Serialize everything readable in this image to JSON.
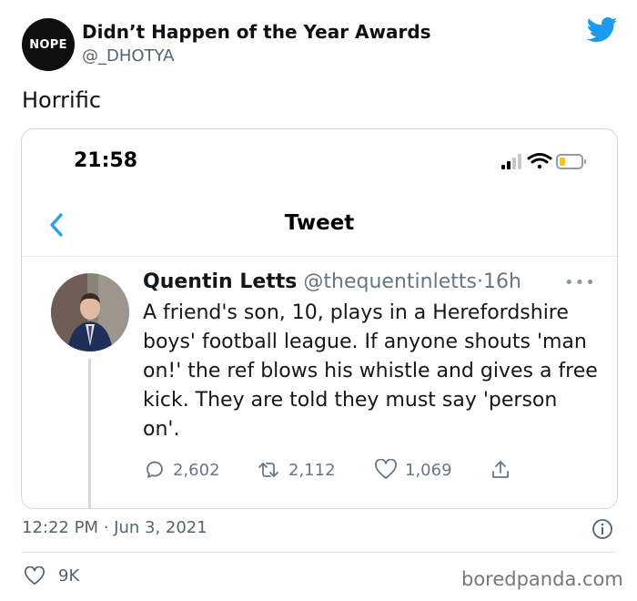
{
  "outer_tweet": {
    "avatar_text": "NOPE",
    "display_name": "Didn’t Happen of the Year Awards",
    "handle": "@_DHOTYA",
    "text": "Horrific",
    "timestamp": "12:22 PM · Jun 3, 2021",
    "likes": "9K"
  },
  "embedded_screenshot": {
    "status_bar": {
      "time": "21:58"
    },
    "nav": {
      "title": "Tweet"
    },
    "tweet": {
      "name": "Quentin Letts",
      "handle": "@thequentinletts",
      "separator": "·",
      "age": "16h",
      "more": "•••",
      "body": "A friend's son, 10, plays in a Herefordshire boys' football league. If anyone shouts 'man on!' the ref blows his whistle and gives a free kick. They are told they must say 'person on'.",
      "replies": "2,602",
      "retweets": "2,112",
      "likes": "1,069"
    }
  },
  "watermark": "boredpanda.com",
  "colors": {
    "twitter_blue": "#1d9bf0",
    "ios_blue": "#1da1f2",
    "battery_yellow": "#f5c518"
  }
}
